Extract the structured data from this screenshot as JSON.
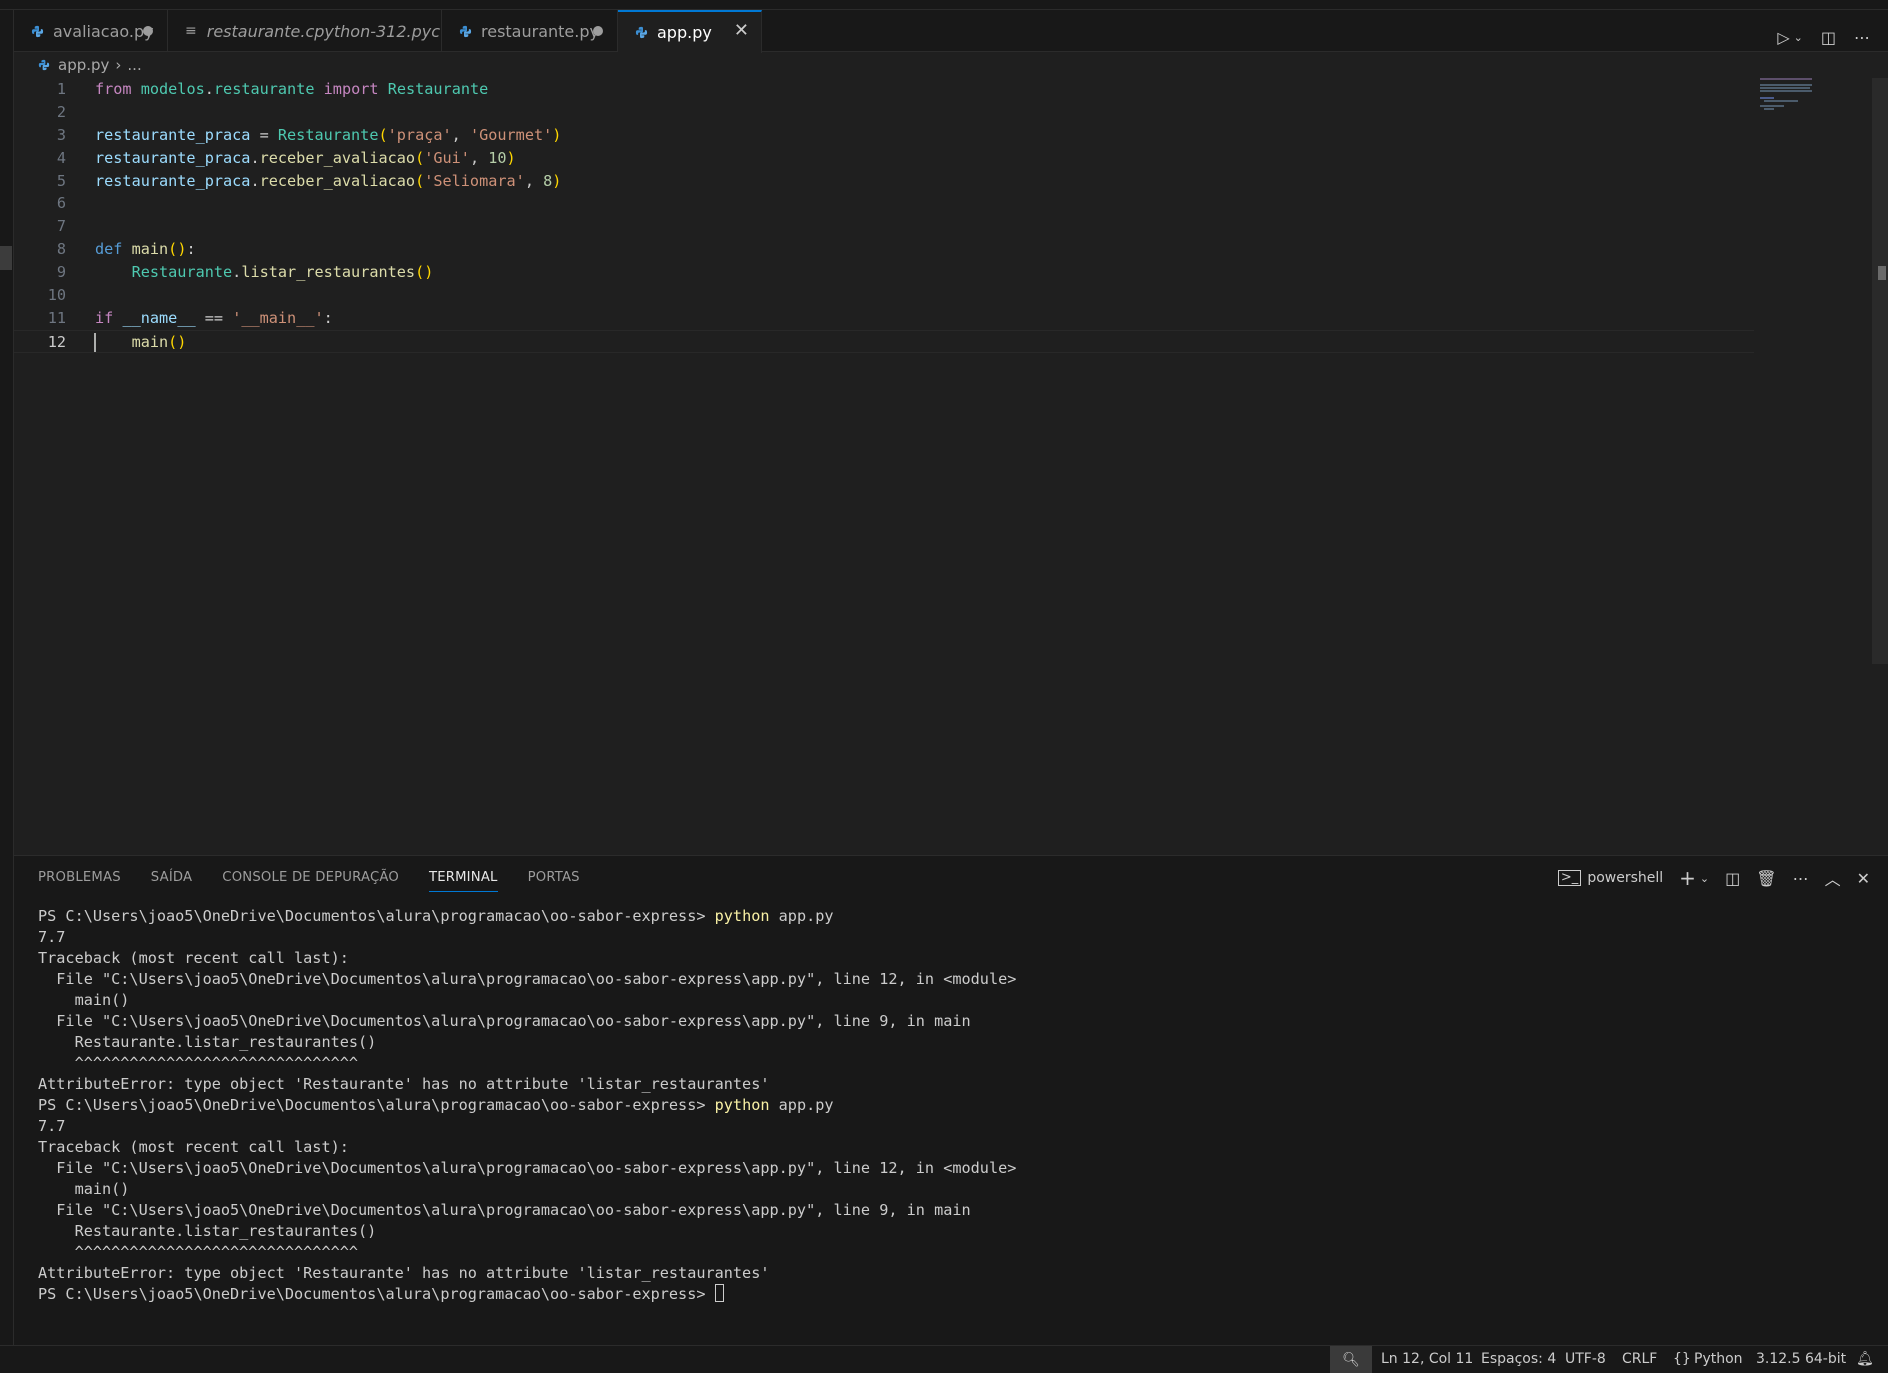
{
  "tabs": [
    {
      "label": "avaliacao.py",
      "icon": "python-icon",
      "modified": true
    },
    {
      "label": "restaurante.cpython-312.pyc",
      "icon": "file-icon",
      "modified": false
    },
    {
      "label": "restaurante.py",
      "icon": "python-icon",
      "modified": true
    },
    {
      "label": "app.py",
      "icon": "python-icon",
      "active": true
    }
  ],
  "breadcrumb": {
    "file": "app.py",
    "rest": "..."
  },
  "editor": {
    "line_numbers": [
      "1",
      "2",
      "3",
      "4",
      "5",
      "6",
      "7",
      "8",
      "9",
      "10",
      "11",
      "12"
    ],
    "current_line": 12
  },
  "panel": {
    "tabs": [
      "PROBLEMAS",
      "SAÍDA",
      "CONSOLE DE DEPURAÇÃO",
      "TERMINAL",
      "PORTAS"
    ],
    "active_tab": "TERMINAL",
    "shell": "powershell",
    "terminal_lines": [
      {
        "prompt": "PS C:\\Users\\joao5\\OneDrive\\Documentos\\alura\\programacao\\oo-sabor-express> ",
        "cmd": "python",
        "args": " app.py"
      },
      {
        "text": "7.7"
      },
      {
        "text": "Traceback (most recent call last):"
      },
      {
        "text": "  File \"C:\\Users\\joao5\\OneDrive\\Documentos\\alura\\programacao\\oo-sabor-express\\app.py\", line 12, in <module>"
      },
      {
        "text": "    main()"
      },
      {
        "text": "  File \"C:\\Users\\joao5\\OneDrive\\Documentos\\alura\\programacao\\oo-sabor-express\\app.py\", line 9, in main"
      },
      {
        "text": "    Restaurante.listar_restaurantes()"
      },
      {
        "text": "    ^^^^^^^^^^^^^^^^^^^^^^^^^^^^^^^"
      },
      {
        "text": "AttributeError: type object 'Restaurante' has no attribute 'listar_restaurantes'"
      },
      {
        "prompt": "PS C:\\Users\\joao5\\OneDrive\\Documentos\\alura\\programacao\\oo-sabor-express> ",
        "cmd": "python",
        "args": " app.py"
      },
      {
        "text": "7.7"
      },
      {
        "text": "Traceback (most recent call last):"
      },
      {
        "text": "  File \"C:\\Users\\joao5\\OneDrive\\Documentos\\alura\\programacao\\oo-sabor-express\\app.py\", line 12, in <module>"
      },
      {
        "text": "    main()"
      },
      {
        "text": "  File \"C:\\Users\\joao5\\OneDrive\\Documentos\\alura\\programacao\\oo-sabor-express\\app.py\", line 9, in main"
      },
      {
        "text": "    Restaurante.listar_restaurantes()"
      },
      {
        "text": "    ^^^^^^^^^^^^^^^^^^^^^^^^^^^^^^^"
      },
      {
        "text": "AttributeError: type object 'Restaurante' has no attribute 'listar_restaurantes'"
      },
      {
        "prompt": "PS C:\\Users\\joao5\\OneDrive\\Documentos\\alura\\programacao\\oo-sabor-express> ",
        "cursor": true
      }
    ]
  },
  "status": {
    "position": "Ln 12, Col 11",
    "spaces": "Espaços: 4",
    "encoding": "UTF-8",
    "eol": "CRLF",
    "language": "Python",
    "interpreter": "3.12.5 64-bit"
  },
  "colors": {
    "accent": "#0078d4",
    "background": "#1f1f1f",
    "sidebar": "#181818"
  }
}
